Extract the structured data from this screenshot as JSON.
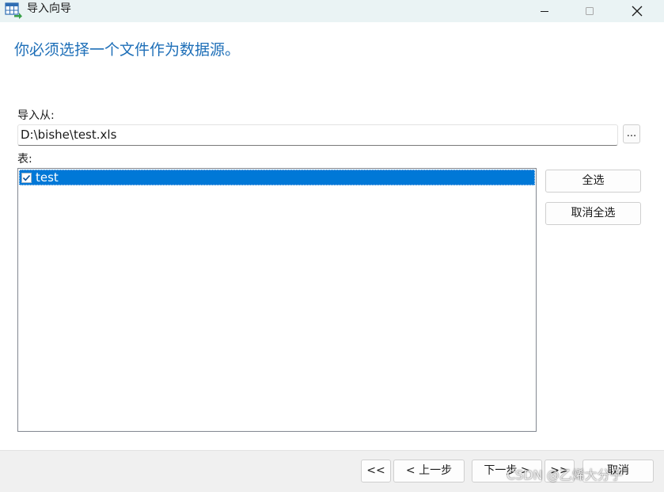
{
  "window": {
    "title": "导入向导",
    "icon": "table-import-icon",
    "controls": [
      "minimize-icon",
      "maximize-icon",
      "close-icon"
    ]
  },
  "main": {
    "heading": "你必须选择一个文件作为数据源。",
    "import_from_label": "导入从:",
    "file_path": "D:\\bishe\\test.xls",
    "browse_label": "...",
    "tables_label": "表:",
    "tables": [
      {
        "name": "test",
        "checked": true,
        "selected": true
      }
    ],
    "select_all_label": "全选",
    "deselect_all_label": "取消全选"
  },
  "footer": {
    "first_label": "<<",
    "prev_label": "< 上一步",
    "next_label": "下一步 >",
    "last_label": ">>",
    "cancel_label": "取消"
  },
  "watermark": "CSDN @乙烯大分子",
  "colors": {
    "heading": "#1e6fb8",
    "selection": "#0078d7",
    "titlebar": "#eaf3f4",
    "footer": "#f0f0f0"
  }
}
